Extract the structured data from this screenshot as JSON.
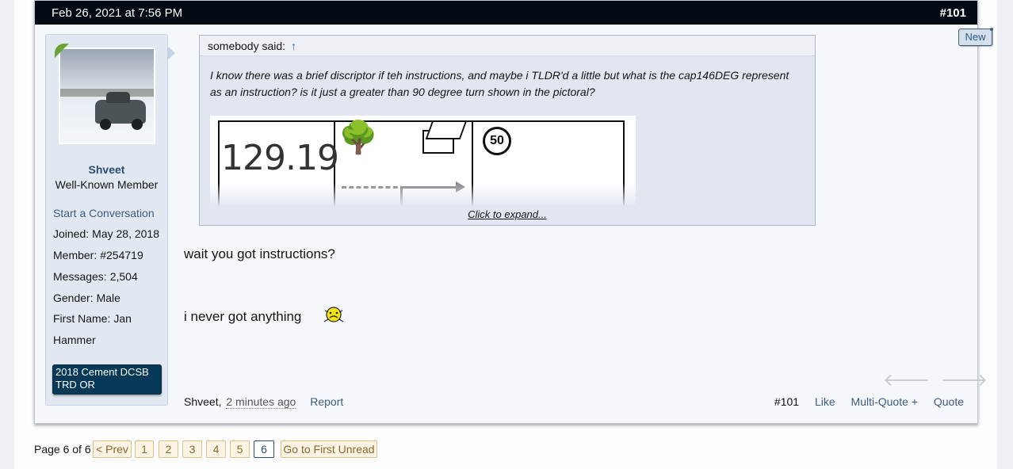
{
  "post": {
    "date": "Feb 26, 2021 at 7:56 PM",
    "number": "#101",
    "new_badge": "New"
  },
  "user": {
    "name": "Shveet",
    "title": "Well-Known Member",
    "start_conversation": "Start a Conversation",
    "info": [
      {
        "label": "Joined:",
        "value": "May 28, 2018"
      },
      {
        "label": "Member:",
        "value": "#254719"
      },
      {
        "label": "Messages:",
        "value": "2,504"
      },
      {
        "label": "Gender:",
        "value": "Male"
      },
      {
        "label": "First Name:",
        "value": "Jan"
      }
    ],
    "first_name_cont": "Hammer",
    "vehicle": "2018 Cement DCSB TRD OR"
  },
  "quote": {
    "author": "somebody said:",
    "arrow": "↑",
    "text": "I know there was a brief discriptor if teh instructions, and maybe i TLDR'd a little but what is the cap146DEG represent as an instruction? is it just a greater than 90 degree turn shown in the pictoral?",
    "image_number": "129.19",
    "image_sign": "50",
    "expand": "Click to expand..."
  },
  "message": {
    "line1": "wait you got instructions?",
    "line2": "i never got anything"
  },
  "footer": {
    "author": "Shveet,",
    "time": "2 minutes ago",
    "report": "Report",
    "post_number": "#101",
    "like": "Like",
    "multi_quote": "Multi-Quote +",
    "quote": "Quote"
  },
  "icons": {
    "prev": "arrow-left-icon",
    "next": "arrow-right-icon"
  },
  "pager": {
    "label": "Page 6 of 6",
    "prev": "< Prev",
    "pages": [
      "1",
      "2",
      "3",
      "4",
      "5",
      "6"
    ],
    "current": "6",
    "first_unread": "Go to First Unread"
  }
}
